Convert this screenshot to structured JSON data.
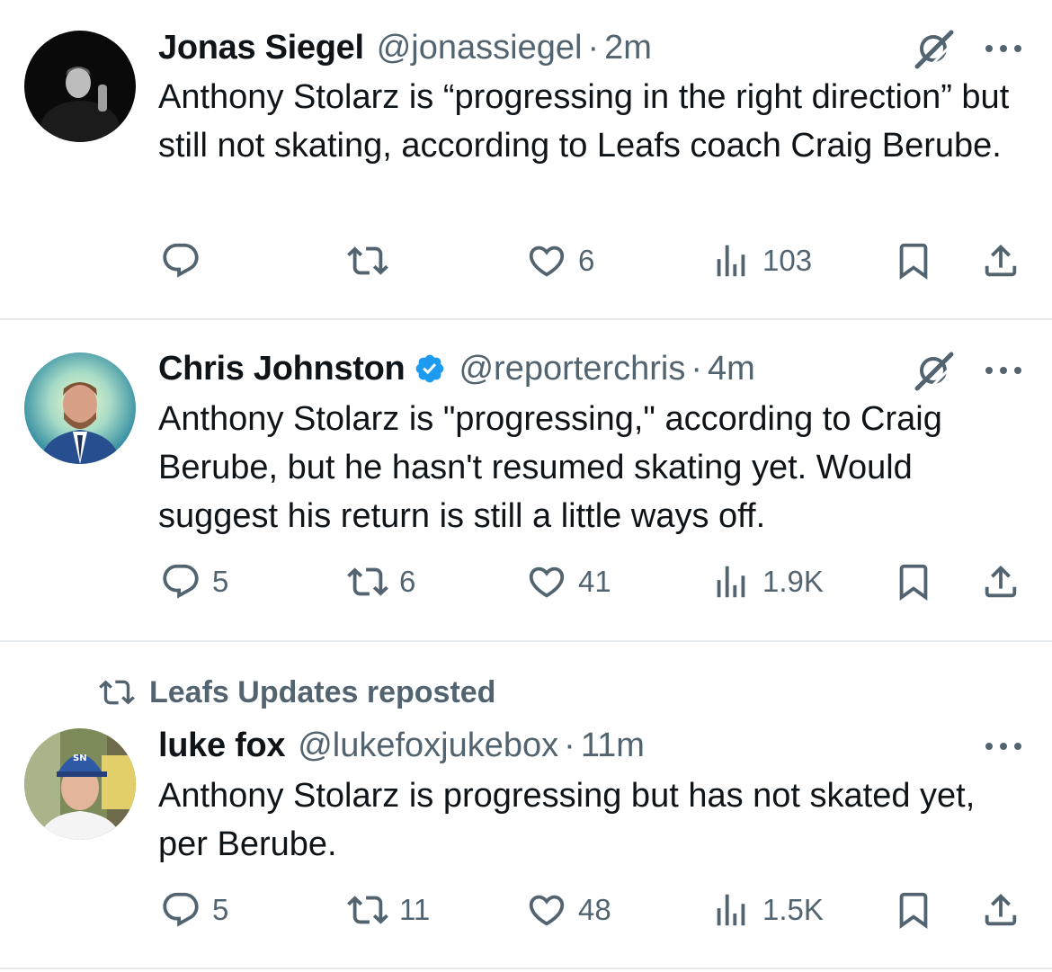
{
  "colors": {
    "muted": "#536471",
    "text": "#0f1419",
    "verified": "#1d9bf0",
    "divider": "#e7eaed"
  },
  "tweets": [
    {
      "name": "Jonas Siegel",
      "handle": "@jonassiegel",
      "separator": "·",
      "time": "2m",
      "verified": false,
      "text": "Anthony Stolarz is “progressing in the right direction” but still not skating, according to Leafs coach Craig Berube.",
      "reply_count": "",
      "repost_count": "",
      "like_count": "6",
      "view_count": "103",
      "icons": [
        "reply-icon",
        "repost-icon",
        "like-icon",
        "views-icon",
        "bookmark-icon",
        "share-icon",
        "grok-icon",
        "more-icon"
      ]
    },
    {
      "name": "Chris Johnston",
      "handle": "@reporterchris",
      "separator": "·",
      "time": "4m",
      "verified": true,
      "text": "Anthony Stolarz is \"progressing,\" according to Craig Berube, but he hasn't resumed skating yet. Would suggest his return is still a little ways off.",
      "reply_count": "5",
      "repost_count": "6",
      "like_count": "41",
      "view_count": "1.9K",
      "icons": [
        "reply-icon",
        "repost-icon",
        "like-icon",
        "views-icon",
        "bookmark-icon",
        "share-icon",
        "grok-icon",
        "more-icon",
        "verified-badge-icon"
      ]
    },
    {
      "repost_label": "Leafs Updates reposted",
      "name": "luke fox",
      "handle": "@lukefoxjukebox",
      "separator": "·",
      "time": "11m",
      "verified": false,
      "text": "Anthony Stolarz is progressing but has not skated yet, per Berube.",
      "reply_count": "5",
      "repost_count": "11",
      "like_count": "48",
      "view_count": "1.5K",
      "icons": [
        "reply-icon",
        "repost-icon",
        "like-icon",
        "views-icon",
        "bookmark-icon",
        "share-icon",
        "more-icon"
      ]
    }
  ]
}
